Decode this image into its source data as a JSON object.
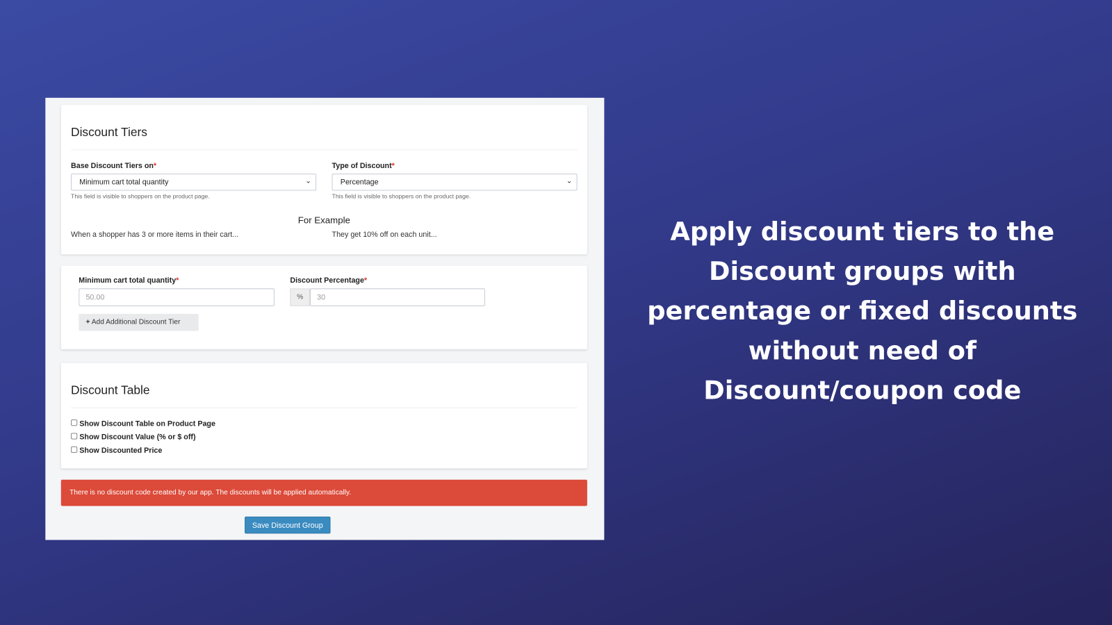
{
  "tiers": {
    "title": "Discount Tiers",
    "base_label": "Base Discount Tiers on",
    "base_value": "Minimum cart total quantity",
    "type_label": "Type of Discount",
    "type_value": "Percentage",
    "help": "This field is visible to shoppers on the product page.",
    "example_title": "For Example",
    "example_left": "When a shopper has 3 or more items in their cart...",
    "example_right": "They get 10% off on each unit...",
    "required_mark": "*"
  },
  "tier_row": {
    "qty_label": "Minimum cart total quantity",
    "qty_placeholder": "50.00",
    "pct_label": "Discount Percentage",
    "pct_addon": "%",
    "pct_placeholder": "30",
    "add_button": "Add Additional Discount Tier"
  },
  "table": {
    "title": "Discount Table",
    "options": [
      {
        "label": "Show Discount Table on Product Page",
        "checked": false
      },
      {
        "label": "Show Discount Value (% or $ off)",
        "checked": false
      },
      {
        "label": "Show Discounted Price",
        "checked": false
      }
    ]
  },
  "alert": "There is no discount code created by our app. The discounts will be applied automatically.",
  "save_button": "Save Discount Group",
  "headline": "Apply discount tiers to the Discount groups with percentage or fixed discounts without need of Discount/coupon code",
  "colors": {
    "alert": "#dc4a39",
    "primary": "#3a8bc0",
    "required": "#d9342b"
  }
}
